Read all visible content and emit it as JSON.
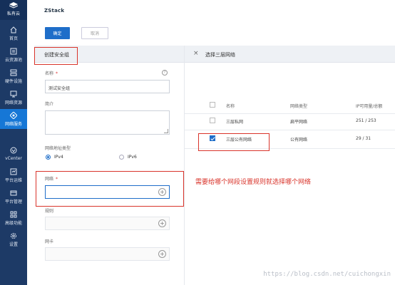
{
  "sidebar": {
    "top_label": "私有云",
    "items": [
      {
        "label": "首页",
        "icon": "home-icon"
      },
      {
        "label": "云资源池",
        "icon": "cloud-pool-icon"
      },
      {
        "label": "硬件设施",
        "icon": "hardware-icon"
      },
      {
        "label": "网络资源",
        "icon": "network-resource-icon"
      },
      {
        "label": "网络服务",
        "icon": "network-service-icon"
      },
      {
        "label": "vCenter",
        "icon": "vcenter-icon"
      },
      {
        "label": "平台运维",
        "icon": "ops-icon"
      },
      {
        "label": "平台管理",
        "icon": "platform-manage-icon"
      },
      {
        "label": "高级功能",
        "icon": "advanced-icon"
      },
      {
        "label": "设置",
        "icon": "settings-icon"
      }
    ]
  },
  "brand": "ZStack",
  "toolbar": {
    "ok_label": "确定",
    "cancel_label": "取消"
  },
  "form": {
    "title": "创建安全组",
    "name_label": "名称",
    "required_mark": "*",
    "help_mark": "?",
    "name_value": "测试安全组",
    "desc_label": "简介",
    "ip_type_label": "网络地址类型",
    "ipv4_label": "IPv4",
    "ipv6_label": "IPv6",
    "network_label": "网络",
    "rule_label": "规则",
    "nic_label": "网卡",
    "plus": "+"
  },
  "network_select": {
    "close": "×",
    "title": "选择三层网络",
    "columns": [
      "名称",
      "网络类型",
      "IP可用量/总额"
    ],
    "rows": [
      {
        "name": "三层私网",
        "type": "扁平网络",
        "ip": "251 / 253",
        "checked": false
      },
      {
        "name": "三层公有网络",
        "type": "公有网络",
        "ip": "29 / 31",
        "checked": true
      }
    ]
  },
  "annotation": "需要给哪个网段设置规则就选择哪个网络",
  "watermark": "https://blog.csdn.net/cuichongxin",
  "colors": {
    "sidebar": "#1d3a66",
    "active": "#1677d6",
    "primary": "#1f6ec9",
    "highlight": "#d9342b"
  }
}
